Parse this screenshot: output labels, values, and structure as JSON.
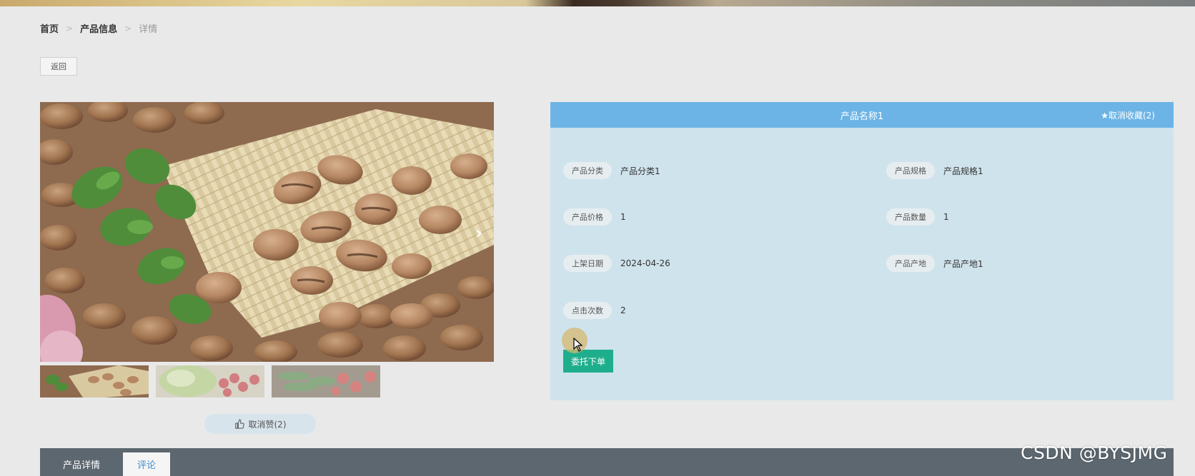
{
  "breadcrumb": {
    "home": "首页",
    "section": "产品信息",
    "current": "详情",
    "separator": ">"
  },
  "back_label": "返回",
  "product": {
    "title": "产品名称1",
    "favorite_label": "★取消收藏(2)",
    "fields": {
      "category": {
        "label": "产品分类",
        "value": "产品分类1"
      },
      "spec": {
        "label": "产品规格",
        "value": "产品规格1"
      },
      "price": {
        "label": "产品价格",
        "value": "1"
      },
      "quantity": {
        "label": "产品数量",
        "value": "1"
      },
      "date": {
        "label": "上架日期",
        "value": "2024-04-26"
      },
      "origin": {
        "label": "产品产地",
        "value": "产品产地1"
      },
      "clicks": {
        "label": "点击次数",
        "value": "2"
      }
    },
    "order_label": "委托下单",
    "like_label": "取消赞(2)"
  },
  "gallery": {
    "next_icon": "chevron-right-icon",
    "thumbnails": [
      "broad-beans",
      "vegetables-cherries",
      "cucumbers-tomatoes"
    ]
  },
  "tabs": [
    "产品详情",
    "评论"
  ],
  "active_tab": "评论",
  "watermark": "CSDN @BYSJMG",
  "colors": {
    "header_blue": "#6cb4e6",
    "panel_bg": "#cfe3ec",
    "order_green": "#1fae8c",
    "tab_bar": "#5c6770",
    "active_tab_text": "#3f8fd0"
  }
}
